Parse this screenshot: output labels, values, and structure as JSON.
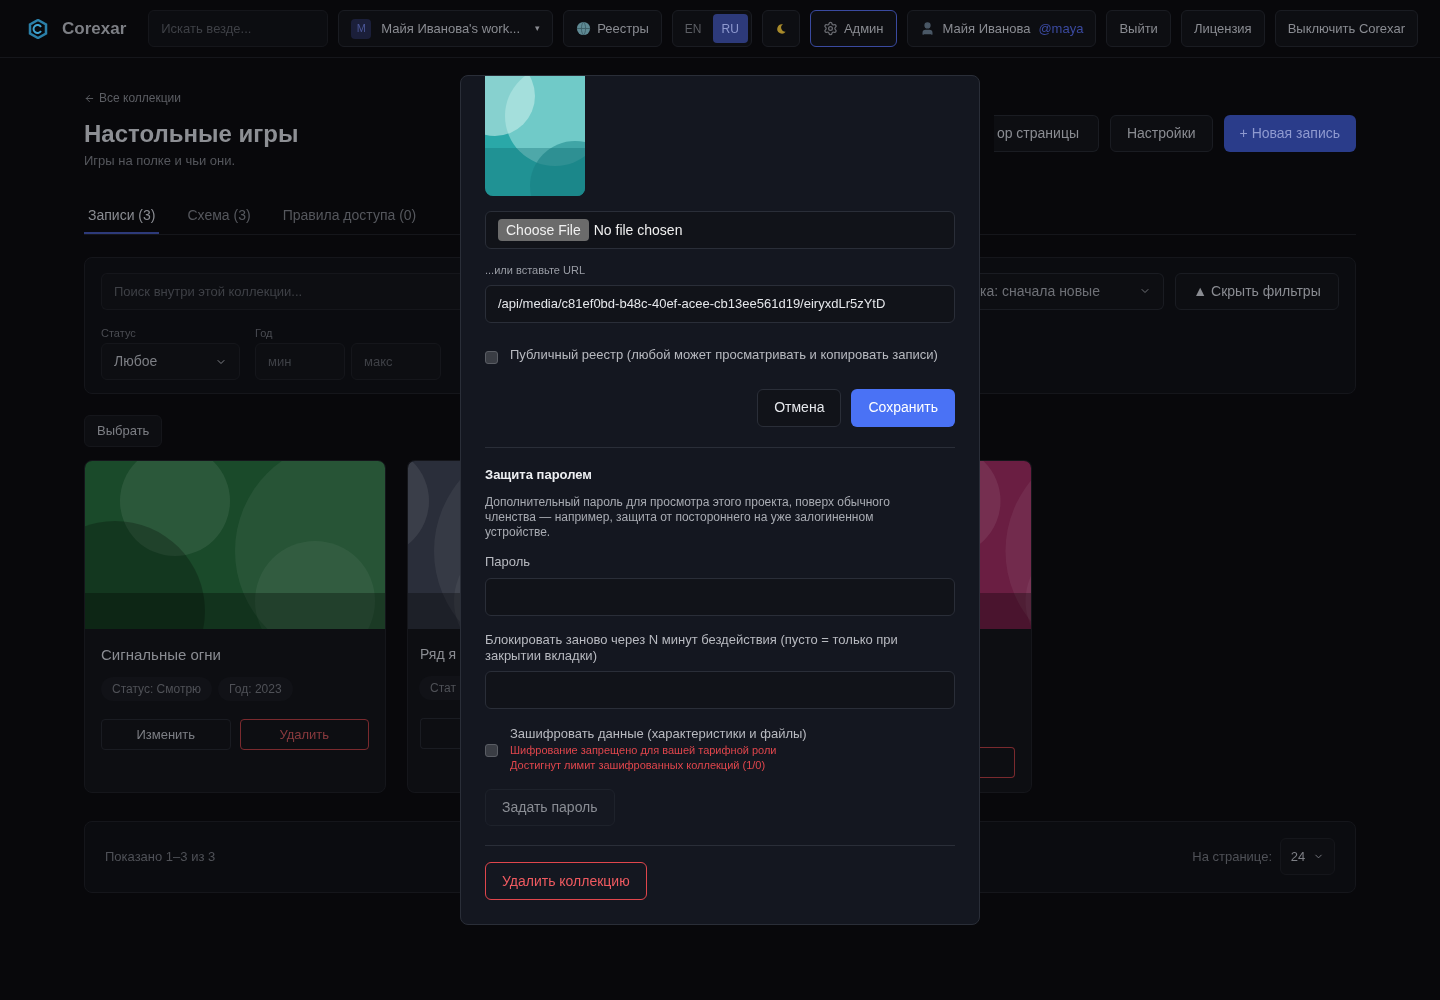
{
  "header": {
    "brand": "Corexar",
    "search": {
      "placeholder": "Искать везде..."
    },
    "workspace": {
      "badge": "M",
      "label": "Майя Иванова's work...",
      "caret": "▾"
    },
    "registries": "Реестры",
    "languages": [
      {
        "label": "EN",
        "selected": false
      },
      {
        "label": "RU",
        "selected": true
      }
    ],
    "admin": {
      "label": "Админ",
      "selected": true
    },
    "user": {
      "name": "Майя Иванова",
      "handle": "@maya"
    },
    "buttons": [
      "Выйти",
      "Лицензия",
      "Выключить Corexar"
    ]
  },
  "page": {
    "back_link": "Все коллекции",
    "title": "Настольные игры",
    "subtitle": "Игры на полке и чьи они.",
    "actions": [
      {
        "label": "ор страницы",
        "kind": "clipped"
      },
      {
        "label": "Настройки",
        "kind": "plain"
      },
      {
        "label": "+ Новая запись",
        "kind": "primary"
      }
    ],
    "tabs": [
      {
        "label": "Записи (3)",
        "selected": true
      },
      {
        "label": "Схема (3)",
        "selected": false
      },
      {
        "label": "Правила доступа (0)",
        "selected": false
      }
    ],
    "filters": {
      "search_placeholder": "Поиск внутри этой коллекции...",
      "sort": "ка: сначала новые",
      "hide_button": "▲ Скрыть фильтры",
      "status": {
        "label": "Статус",
        "value": "Любое"
      },
      "year": {
        "label": "Год",
        "min": {
          "placeholder": "мин"
        },
        "max": {
          "placeholder": "макс"
        }
      }
    },
    "select_button": "Выбрать",
    "cards": [
      {
        "kind": "full",
        "color": "#1a4a2a",
        "title": "Сигнальные огни",
        "tags": [
          "Статус: Смотрю",
          "Год: 2023"
        ],
        "edit": "Изменить",
        "delete": "Удалить"
      },
      {
        "kind": "clipped_left",
        "color": "#2a2e3a",
        "title": "Ряд я",
        "tags": [
          "Стат"
        ]
      },
      {
        "kind": "clipped_right",
        "color": "#6a1e42"
      }
    ],
    "footer": {
      "shown": "Показано 1–3 из 3",
      "per_page_label": "На странице:",
      "per_page": "24"
    }
  },
  "modal": {
    "file": {
      "button": "Choose File",
      "status": "No file chosen"
    },
    "url_label": "...или вставьте URL",
    "url_value": "/api/media/c81ef0bd-b48c-40ef-acee-cb13ee561d19/eiryxdLr5zYtD",
    "public": {
      "label": "Публичный реестр (любой может просматривать и копировать записи)",
      "checked": false
    },
    "cancel": "Отмена",
    "save": "Сохранить",
    "password": {
      "title": "Защита паролем",
      "description": "Дополнительный пароль для просмотра этого проекта, поверх обычного членства — например, защита от постороннего на уже залогиненном устройстве.",
      "password_label": "Пароль",
      "lock_label": "Блокировать заново через N минут бездействия (пусто = только при закрытии вкладки)",
      "encrypt": {
        "label": "Зашифровать данные (характеристики и файлы)",
        "checked": false,
        "errors": [
          "Шифрование запрещено для вашей тарифной роли",
          "Достигнут лимит зашифрованных коллекций (1/0)"
        ]
      },
      "set_button": {
        "label": "Задать пароль",
        "disabled": true
      }
    },
    "delete": "Удалить коллекцию"
  }
}
